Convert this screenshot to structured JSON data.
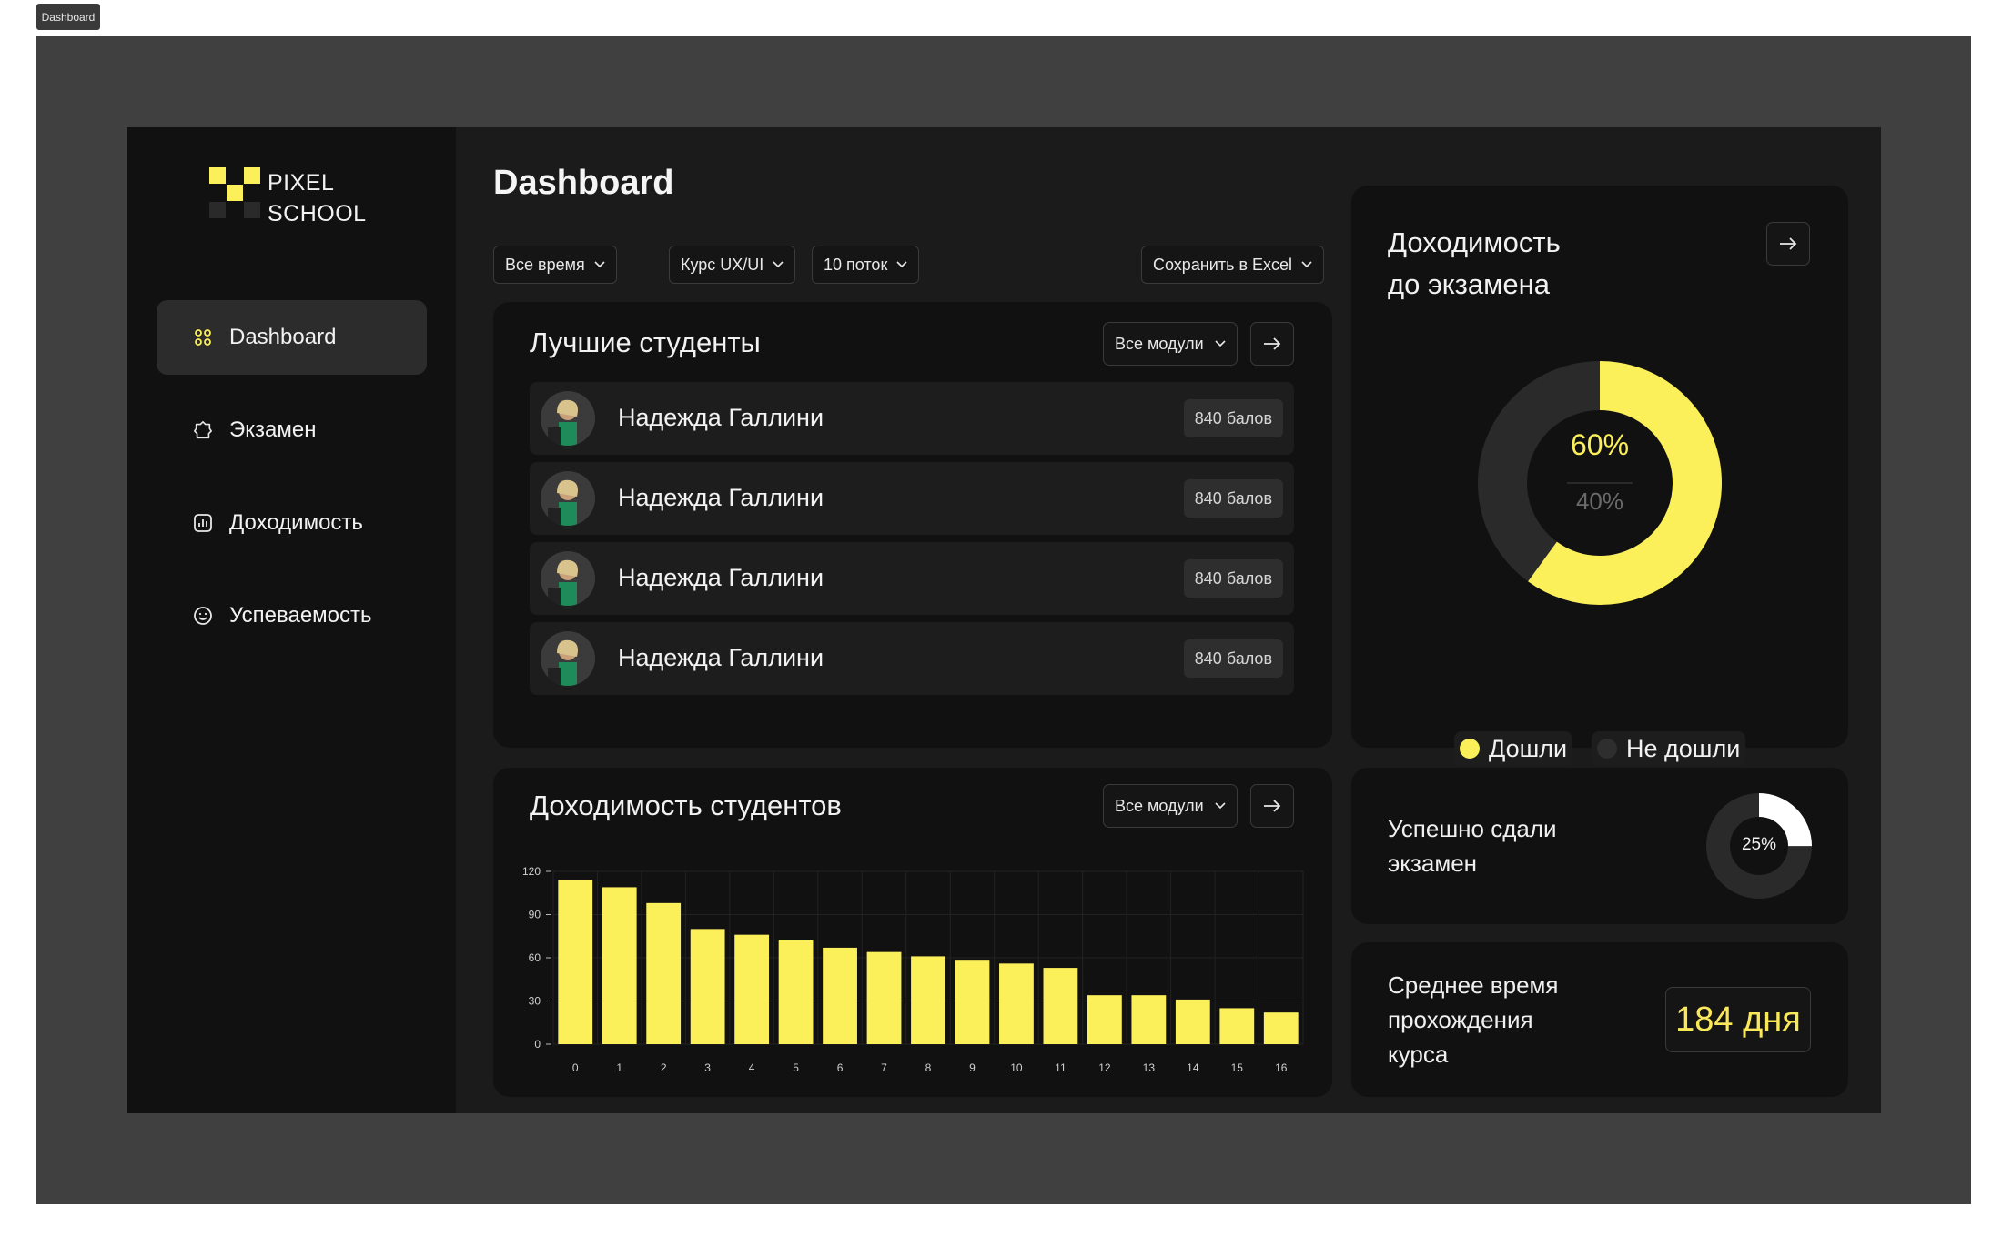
{
  "frame_label": "Dashboard",
  "logo": {
    "line1": "PIXEL",
    "line2": "SCHOOL"
  },
  "sidebar": {
    "items": [
      {
        "label": "Dashboard",
        "icon": "grid-icon",
        "active": true
      },
      {
        "label": "Экзамен",
        "icon": "badge-icon",
        "active": false
      },
      {
        "label": "Доходимость",
        "icon": "chart-icon",
        "active": false
      },
      {
        "label": "Успеваемость",
        "icon": "smile-icon",
        "active": false
      }
    ]
  },
  "page_title": "Dashboard",
  "filters": {
    "period": "Все время",
    "course": "Курс UX/UI",
    "stream": "10 поток",
    "export": "Сохранить в Excel"
  },
  "best_students": {
    "title": "Лучшие студенты",
    "module_select": "Все модули",
    "rows": [
      {
        "name": "Надежда Галлини",
        "score": "840 балов"
      },
      {
        "name": "Надежда Галлини",
        "score": "840 балов"
      },
      {
        "name": "Надежда Галлини",
        "score": "840 балов"
      },
      {
        "name": "Надежда Галлини",
        "score": "840 балов"
      }
    ]
  },
  "retention_exam": {
    "title_line1": "Доходимость",
    "title_line2": "до экзамена",
    "reached_pct": "60%",
    "not_reached_pct": "40%",
    "reached_fraction": 0.6,
    "legend_reached": "Дошли",
    "legend_not_reached": "Не дошли",
    "colors": {
      "reached": "#fbef5a",
      "not_reached": "#2a2a2a"
    }
  },
  "passed_exam": {
    "line1": "Успешно сдали",
    "line2": "экзамен",
    "pct": "25%",
    "fraction": 0.25
  },
  "avg_time": {
    "line1": "Среднее время",
    "line2": "прохождения",
    "line3": "курса",
    "value": "184 дня"
  },
  "students_retention": {
    "title": "Доходимость студентов",
    "module_select": "Все модули"
  },
  "chart_data": {
    "type": "bar",
    "title": "Доходимость студентов",
    "categories": [
      "0",
      "1",
      "2",
      "3",
      "4",
      "5",
      "6",
      "7",
      "8",
      "9",
      "10",
      "11",
      "12",
      "13",
      "14",
      "15",
      "16"
    ],
    "values": [
      114,
      109,
      98,
      80,
      76,
      72,
      67,
      64,
      61,
      58,
      56,
      53,
      34,
      34,
      31,
      25,
      22
    ],
    "ylim": [
      0,
      120
    ],
    "yticks": [
      "0",
      "30",
      "60",
      "90",
      "120"
    ],
    "grid": true,
    "bar_color": "#fbef5a"
  }
}
